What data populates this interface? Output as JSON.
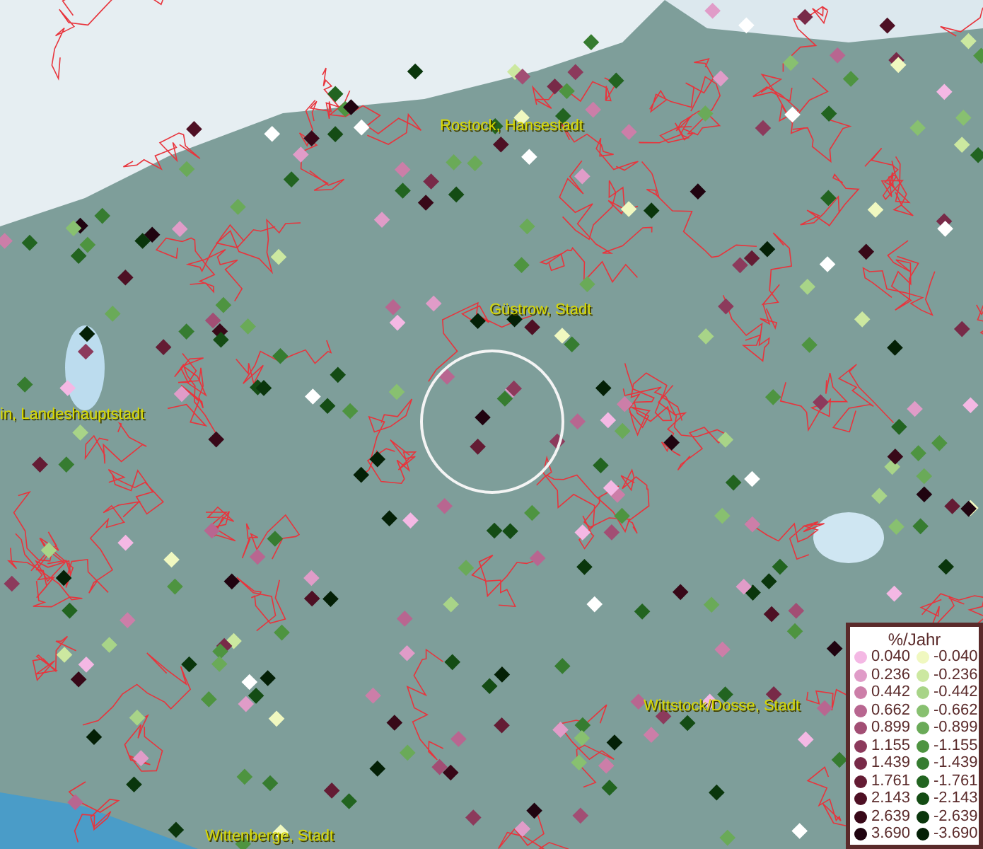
{
  "map": {
    "labels": [
      {
        "text": "Rostock, Hansestadt"
      },
      {
        "text": "Güstrow, Stadt"
      },
      {
        "text": "in, Landeshauptstadt"
      },
      {
        "text": "Wittstock/Dosse, Stadt"
      },
      {
        "text": "Wittenberge, Stadt"
      }
    ]
  },
  "legend": {
    "title": "%/Jahr",
    "items": [
      {
        "label": "0.040",
        "color": "#f4b8e4"
      },
      {
        "label": "-0.040",
        "color": "#f0f8c0"
      },
      {
        "label": "0.236",
        "color": "#e09cc8"
      },
      {
        "label": "-0.236",
        "color": "#cce8a0"
      },
      {
        "label": "0.442",
        "color": "#cc7ea8"
      },
      {
        "label": "-0.442",
        "color": "#a8d488"
      },
      {
        "label": "0.662",
        "color": "#b86690"
      },
      {
        "label": "-0.662",
        "color": "#88c070"
      },
      {
        "label": "0.899",
        "color": "#a24e74"
      },
      {
        "label": "-0.899",
        "color": "#6aaa58"
      },
      {
        "label": "1.155",
        "color": "#8c3a5c"
      },
      {
        "label": "-1.155",
        "color": "#4e9440"
      },
      {
        "label": "1.439",
        "color": "#782a48"
      },
      {
        "label": "-1.439",
        "color": "#367c30"
      },
      {
        "label": "1.761",
        "color": "#641c34"
      },
      {
        "label": "-1.761",
        "color": "#226420"
      },
      {
        "label": "2.143",
        "color": "#4e1024"
      },
      {
        "label": "-2.143",
        "color": "#144c14"
      },
      {
        "label": "2.639",
        "color": "#380818"
      },
      {
        "label": "-2.639",
        "color": "#0a360c"
      },
      {
        "label": "3.690",
        "color": "#200410"
      },
      {
        "label": "-3.690",
        "color": "#042006"
      }
    ]
  }
}
